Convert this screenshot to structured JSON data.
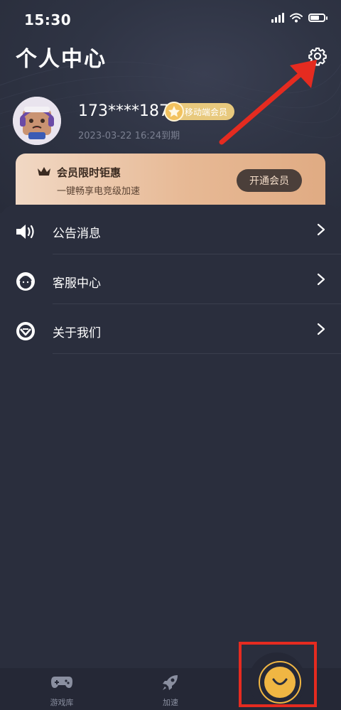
{
  "status_bar": {
    "time": "15:30"
  },
  "header": {
    "title": "个人中心",
    "settings_icon": "gear-icon"
  },
  "profile": {
    "username": "173****1871",
    "member_badge": "移动端会员",
    "expiry": "2023-03-22 16:24到期"
  },
  "promo": {
    "title": "会员限时钜惠",
    "subtitle": "一键畅享电竞级加速",
    "button_label": "开通会员"
  },
  "menu": {
    "items": [
      {
        "label": "公告消息",
        "icon": "speaker-icon"
      },
      {
        "label": "客服中心",
        "icon": "headset-icon"
      },
      {
        "label": "关于我们",
        "icon": "about-logo-icon"
      }
    ]
  },
  "tabbar": {
    "tabs": [
      {
        "label": "游戏库",
        "icon": "gamepad-icon"
      },
      {
        "label": "加速",
        "icon": "rocket-icon"
      }
    ],
    "active_icon": "smile-icon"
  },
  "colors": {
    "background": "#2a2e3d",
    "accent_gold": "#f0b643",
    "promo_gradient_start": "#f1d8c4",
    "promo_gradient_end": "#e0ab83",
    "annotation_red": "#e52b20"
  }
}
